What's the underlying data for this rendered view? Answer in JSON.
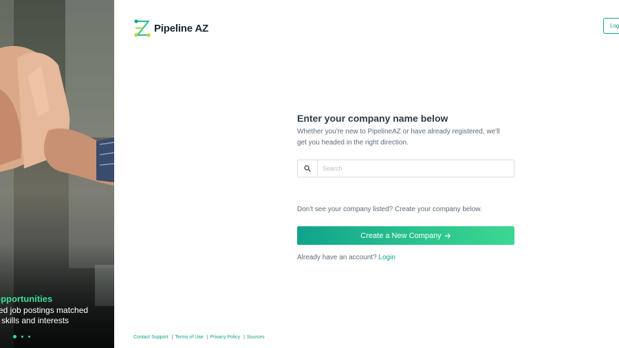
{
  "brand": {
    "name": "Pipeline AZ",
    "accent": "#12a18a",
    "accent_light": "#3ddc97"
  },
  "header": {
    "login_label": "Log"
  },
  "hero": {
    "headline": "te opportunities",
    "body_line1": "mited job postings matched",
    "body_line2": "ate skills and interests",
    "slides_total": 3,
    "slide_active": 1
  },
  "form": {
    "title": "Enter your company name below",
    "subtitle_line1": "Whether you're new to PipelineAZ or have already registered, we'll",
    "subtitle_line2": "get you headed in the right direction.",
    "search": {
      "placeholder": "Search",
      "value": "",
      "icon": "search-icon"
    },
    "no_company_text": "Don't see your company listed? Create your company below.",
    "create_button_label": "Create a New Company",
    "create_button_icon": "arrow-right-icon",
    "have_account_text": "Already have an account?",
    "login_link": "Login"
  },
  "footer": {
    "links": [
      "Contact Support",
      "Terms of Use",
      "Privacy Policy",
      "Sources"
    ]
  }
}
